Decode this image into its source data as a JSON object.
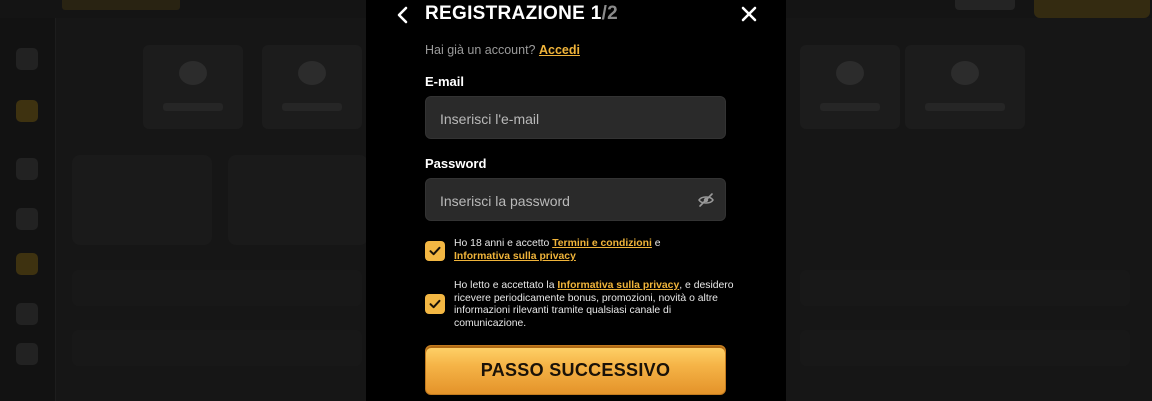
{
  "modal": {
    "title_main": "REGISTRAZIONE ",
    "title_step": "1",
    "title_total": "/2",
    "login_prompt": "Hai già un account? ",
    "login_link": "Accedi",
    "email": {
      "label": "E-mail",
      "placeholder": "Inserisci l'e-mail",
      "value": ""
    },
    "password": {
      "label": "Password",
      "placeholder": "Inserisci la password",
      "value": ""
    },
    "consent1": {
      "checked": true,
      "text_a": "Ho 18 anni e accetto ",
      "link_a": "Termini e condizioni",
      "text_b": " e ",
      "link_b": "Informativa sulla privacy"
    },
    "consent2": {
      "checked": true,
      "text_a": "Ho letto e accettato la ",
      "link_a": "Informativa sulla privacy",
      "text_b": ", e desidero ricevere periodicamente bonus, promozioni, novità o altre informazioni rilevanti tramite qualsiasi canale di comunicazione."
    },
    "submit_label": "PASSO SUCCESSIVO",
    "icons": {
      "back": "chevron-left-icon",
      "close": "close-icon",
      "eye": "eye-off-icon",
      "check": "check-icon"
    },
    "colors": {
      "accent": "#f3b743",
      "link": "#f0b43a",
      "modal_bg": "#000000",
      "field_bg": "#2a2a2a"
    }
  }
}
